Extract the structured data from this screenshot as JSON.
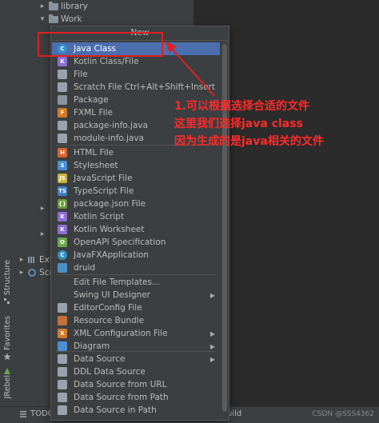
{
  "tree": {
    "library": "library",
    "work": "Work",
    "ext_partial": "Ext",
    "scr_partial": "Scr"
  },
  "tool_windows": {
    "structure": "Structure",
    "favorites": "Favorites",
    "jrebel": "JRebel"
  },
  "bottom_bar": {
    "todo": "TODO",
    "build_partial": "uild",
    "watermark": "CSDN @SSS4362"
  },
  "menu": {
    "title": "New",
    "items": [
      {
        "label": "Java Class",
        "icon": "java-class-icon",
        "color": "#3592c4",
        "glyph": "C",
        "selected": true
      },
      {
        "label": "Kotlin Class/File",
        "icon": "kotlin-file-icon",
        "color": "#8b6fd1",
        "glyph": "K"
      },
      {
        "label": "File",
        "icon": "file-icon",
        "color": "#9aa3ad",
        "glyph": ""
      },
      {
        "label": "Scratch File",
        "icon": "scratch-file-icon",
        "color": "#9aa3ad",
        "glyph": "",
        "shortcut": "Ctrl+Alt+Shift+Insert"
      },
      {
        "label": "Package",
        "icon": "package-icon",
        "color": "#8a94a0",
        "glyph": ""
      },
      {
        "label": "FXML File",
        "icon": "fxml-file-icon",
        "color": "#d47a2a",
        "glyph": "F"
      },
      {
        "label": "package-info.java",
        "icon": "package-info-icon",
        "color": "#9aa3ad",
        "glyph": ""
      },
      {
        "label": "module-info.java",
        "icon": "module-info-icon",
        "color": "#9aa3ad",
        "glyph": ""
      },
      {
        "label": "HTML File",
        "icon": "html-file-icon",
        "color": "#d7642c",
        "glyph": "H"
      },
      {
        "label": "Stylesheet",
        "icon": "stylesheet-icon",
        "color": "#4a8fd4",
        "glyph": "S"
      },
      {
        "label": "JavaScript File",
        "icon": "javascript-file-icon",
        "color": "#c8b43a",
        "glyph": "JS"
      },
      {
        "label": "TypeScript File",
        "icon": "typescript-file-icon",
        "color": "#3f7fc4",
        "glyph": "TS"
      },
      {
        "label": "package.json File",
        "icon": "package-json-icon",
        "color": "#6a9a3a",
        "glyph": "{}"
      },
      {
        "label": "Kotlin Script",
        "icon": "kotlin-script-icon",
        "color": "#8b6fd1",
        "glyph": "K"
      },
      {
        "label": "Kotlin Worksheet",
        "icon": "kotlin-worksheet-icon",
        "color": "#8b6fd1",
        "glyph": "K"
      },
      {
        "label": "OpenAPI Specification",
        "icon": "openapi-icon",
        "color": "#6aa84f",
        "glyph": "O"
      },
      {
        "label": "JavaFXApplication",
        "icon": "javafx-icon",
        "color": "#3592c4",
        "glyph": "C"
      },
      {
        "label": "druid",
        "icon": "druid-icon",
        "color": "#4a90c4",
        "glyph": ""
      },
      {
        "label": "Edit File Templates...",
        "icon": "",
        "color": "",
        "glyph": ""
      },
      {
        "label": "Swing UI Designer",
        "icon": "",
        "color": "",
        "glyph": "",
        "submenu": true
      },
      {
        "label": "EditorConfig File",
        "icon": "editorconfig-icon",
        "color": "#9aa3ad",
        "glyph": ""
      },
      {
        "label": "Resource Bundle",
        "icon": "resource-bundle-icon",
        "color": "#c4703a",
        "glyph": ""
      },
      {
        "label": "XML Configuration File",
        "icon": "xml-config-icon",
        "color": "#d47a2a",
        "glyph": "X",
        "submenu": true
      },
      {
        "label": "Diagram",
        "icon": "diagram-icon",
        "color": "#4a8fd4",
        "glyph": "",
        "submenu": true
      },
      {
        "label": "Data Source",
        "icon": "data-source-icon",
        "color": "#9aa3ad",
        "glyph": "",
        "submenu": true
      },
      {
        "label": "DDL Data Source",
        "icon": "ddl-data-source-icon",
        "color": "#9aa3ad",
        "glyph": ""
      },
      {
        "label": "Data Source from URL",
        "icon": "data-source-url-icon",
        "color": "#9aa3ad",
        "glyph": ""
      },
      {
        "label": "Data Source from Path",
        "icon": "data-source-path-icon",
        "color": "#9aa3ad",
        "glyph": ""
      },
      {
        "label": "Data Source in Path",
        "icon": "data-source-in-path-icon",
        "color": "#9aa3ad",
        "glyph": ""
      }
    ]
  },
  "annotation": {
    "line1": "1.可以根据选择合适的文件",
    "line2": "这里我们选择java class",
    "line3": "因为生成的是java相关的文件",
    "color": "#ff2a2a"
  }
}
